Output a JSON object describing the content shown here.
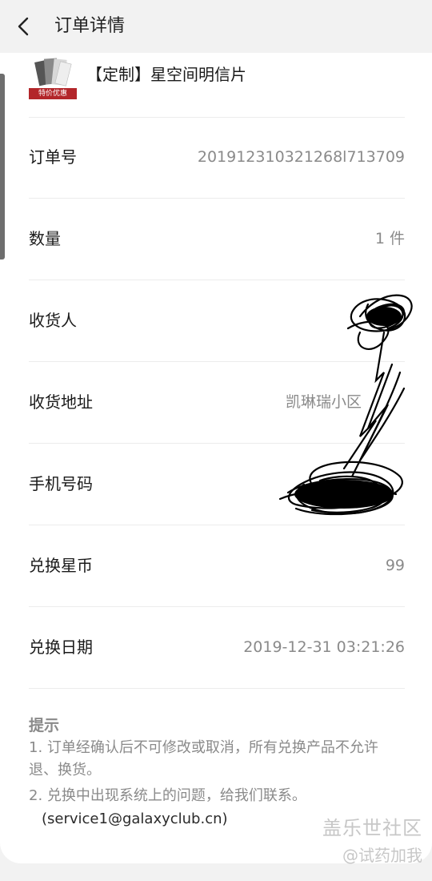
{
  "header": {
    "title": "订单详情",
    "back_icon": "back-chevron-icon"
  },
  "product": {
    "name": "【定制】星空间明信片",
    "badge": "特价优惠"
  },
  "details": [
    {
      "label": "订单号",
      "value": "201912310321268l713709"
    },
    {
      "label": "数量",
      "value": "1 件"
    },
    {
      "label": "收货人",
      "value": ""
    },
    {
      "label": "收货地址",
      "value": "凯琳瑞小区"
    },
    {
      "label": "手机号码",
      "value": ""
    },
    {
      "label": "兑换星币",
      "value": "99"
    },
    {
      "label": "兑换日期",
      "value": "2019-12-31 03:21:26"
    }
  ],
  "tips": {
    "title": "提示",
    "line1": "1. 订单经确认后不可修改或取消，所有兑换产品不允许退、换货。",
    "line2": "2. 兑换中出现系统上的问题，给我们联系。",
    "email": "(service1@galaxyclub.cn)"
  },
  "watermark": {
    "line1": "盖乐世社区",
    "line2": "@试药加我"
  }
}
